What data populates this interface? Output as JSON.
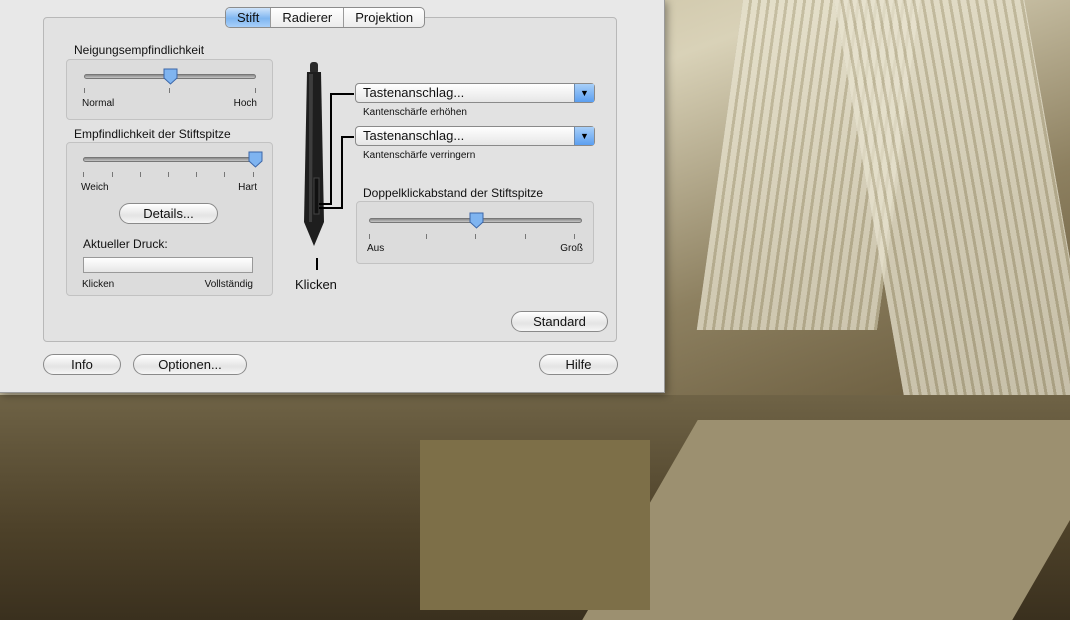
{
  "tabs": [
    "Stift",
    "Radierer",
    "Projektion"
  ],
  "active_tab": "Stift",
  "tilt": {
    "title": "Neigungsempfindlichkeit",
    "min_label": "Normal",
    "max_label": "Hoch",
    "value": 0.5
  },
  "tip": {
    "title": "Empfindlichkeit der Stiftspitze",
    "min_label": "Weich",
    "max_label": "Hart",
    "value": 1.0,
    "details_button": "Details...",
    "pressure_label": "Aktueller Druck:",
    "pressure_value": 0,
    "pressure_min": "Klicken",
    "pressure_max": "Vollständig"
  },
  "pen": {
    "tip_label": "Klicken"
  },
  "button_upper": {
    "value": "Tastenanschlag...",
    "caption": "Kantenschärfe erhöhen"
  },
  "button_lower": {
    "value": "Tastenanschlag...",
    "caption": "Kantenschärfe verringern"
  },
  "doubleclick": {
    "title": "Doppelklickabstand der Stiftspitze",
    "min_label": "Aus",
    "max_label": "Groß",
    "value": 0.5
  },
  "buttons": {
    "standard": "Standard",
    "info": "Info",
    "options": "Optionen...",
    "help": "Hilfe"
  }
}
